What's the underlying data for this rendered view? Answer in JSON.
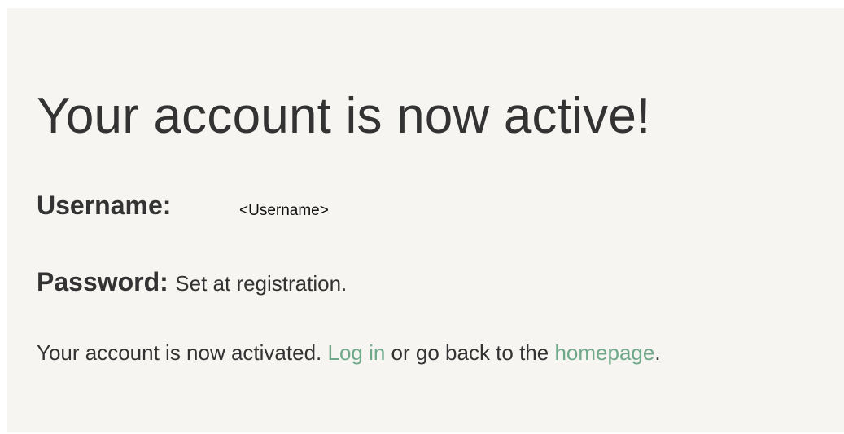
{
  "page": {
    "title": "Your account is now active!",
    "username": {
      "label": "Username:",
      "value": "<Username>"
    },
    "password": {
      "label": "Password:",
      "value": "Set at registration."
    },
    "message": {
      "text_before": "Your account is now activated. ",
      "login_link": "Log in",
      "text_middle": " or go back to the ",
      "homepage_link": "homepage",
      "text_after": "."
    }
  },
  "colors": {
    "panel_background": "#f6f5f2",
    "text": "#333333",
    "link": "#6fa98a"
  }
}
